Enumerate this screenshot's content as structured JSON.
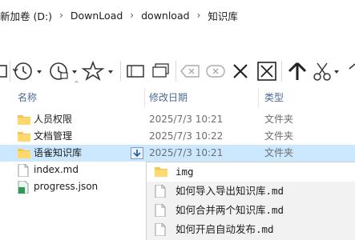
{
  "breadcrumb": {
    "items": [
      "新加卷 (D:)",
      "DownLoad",
      "download",
      "知识库"
    ]
  },
  "columns": {
    "name": "名称",
    "modified": "修改日期",
    "type": "类型"
  },
  "files": [
    {
      "name": "人员权限",
      "date": "2025/7/3 10:21",
      "type": "文件夹",
      "icon": "folder-icon"
    },
    {
      "name": "文档管理",
      "date": "2025/7/3 10:22",
      "type": "文件夹",
      "icon": "folder-icon"
    },
    {
      "name": "语雀知识库",
      "date": "2025/7/3 10:21",
      "type": "文件夹",
      "icon": "folder-icon",
      "selected": true
    },
    {
      "name": "index.md",
      "date": "",
      "type": "",
      "icon": "document-icon"
    },
    {
      "name": "progress.json",
      "date": "",
      "type": "",
      "icon": "json-file-icon"
    }
  ],
  "dropdown": {
    "items": [
      "img",
      "如何导入导出知识库.md",
      "如何合并两个知识库.md",
      "如何开启自动发布.md"
    ]
  },
  "colors": {
    "selection": "#cce8ff",
    "folder": "#f4c454",
    "header_text": "#4d6a93"
  }
}
